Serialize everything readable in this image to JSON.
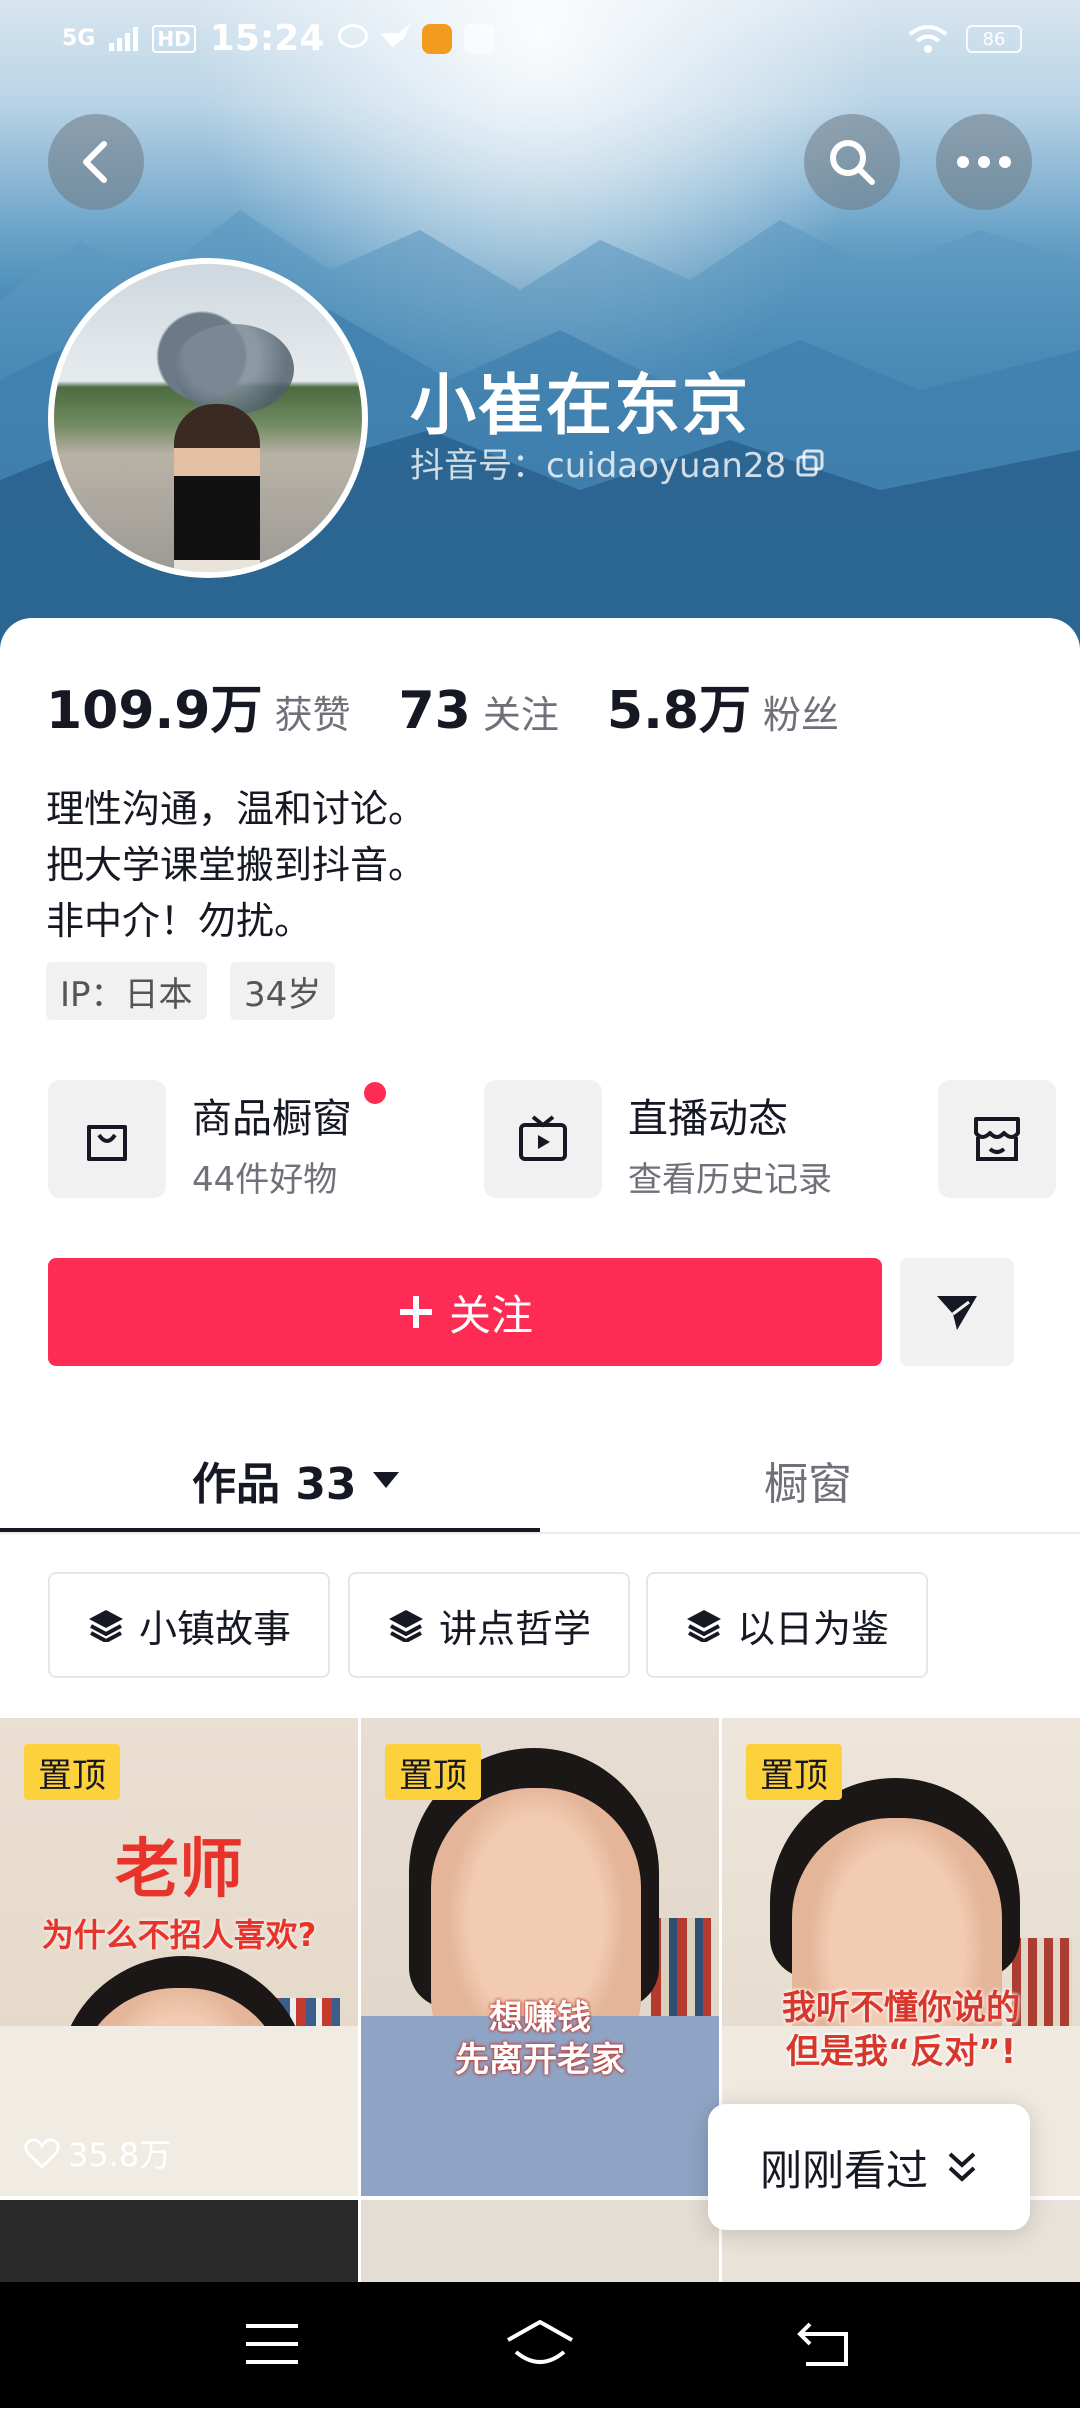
{
  "status_bar": {
    "network": "5G",
    "hd": "HD",
    "time": "15:24",
    "battery": "86"
  },
  "header": {
    "back_icon": "back-arrow-icon",
    "search_icon": "search-icon",
    "more_icon": "more-icon"
  },
  "profile": {
    "name": "小崔在东京",
    "douyin_id": "抖音号：cuidaoyuan28",
    "stats": [
      {
        "value": "109.9万",
        "label": "获赞"
      },
      {
        "value": "73",
        "label": "关注"
      },
      {
        "value": "5.8万",
        "label": "粉丝"
      }
    ],
    "bio": [
      "理性沟通，温和讨论。",
      "把大学课堂搬到抖音。",
      "非中介！勿扰。"
    ],
    "tags": [
      "IP：日本",
      "34岁"
    ]
  },
  "features": [
    {
      "title": "商品橱窗",
      "subtitle": "44件好物",
      "icon": "bag-icon",
      "has_dot": true
    },
    {
      "title": "直播动态",
      "subtitle": "查看历史记录",
      "icon": "tv-play-icon"
    },
    {
      "icon": "store-icon"
    }
  ],
  "actions": {
    "follow_label": "关注",
    "follow_icon": "plus-icon",
    "dm_icon": "send-icon"
  },
  "tabs": [
    {
      "label": "作品 33",
      "active": true
    },
    {
      "label": "橱窗",
      "active": false
    }
  ],
  "collections": [
    "小镇故事",
    "讲点哲学",
    "以日为鉴"
  ],
  "videos": [
    {
      "pin": "置顶",
      "title_line1": "老师",
      "title_line2": "为什么不招人喜欢?",
      "likes": "35.8万"
    },
    {
      "pin": "置顶",
      "title_line1": "想赚钱",
      "title_line2": "先离开老家"
    },
    {
      "pin": "置顶",
      "title_line1": "我听不懂你说的",
      "title_line2": "但是我“反对”!"
    }
  ],
  "recent_popup": {
    "label": "刚刚看过"
  },
  "colors": {
    "accent": "#fe2c55",
    "pin": "#fdd13c",
    "bg_blue": "#2f78a8"
  }
}
